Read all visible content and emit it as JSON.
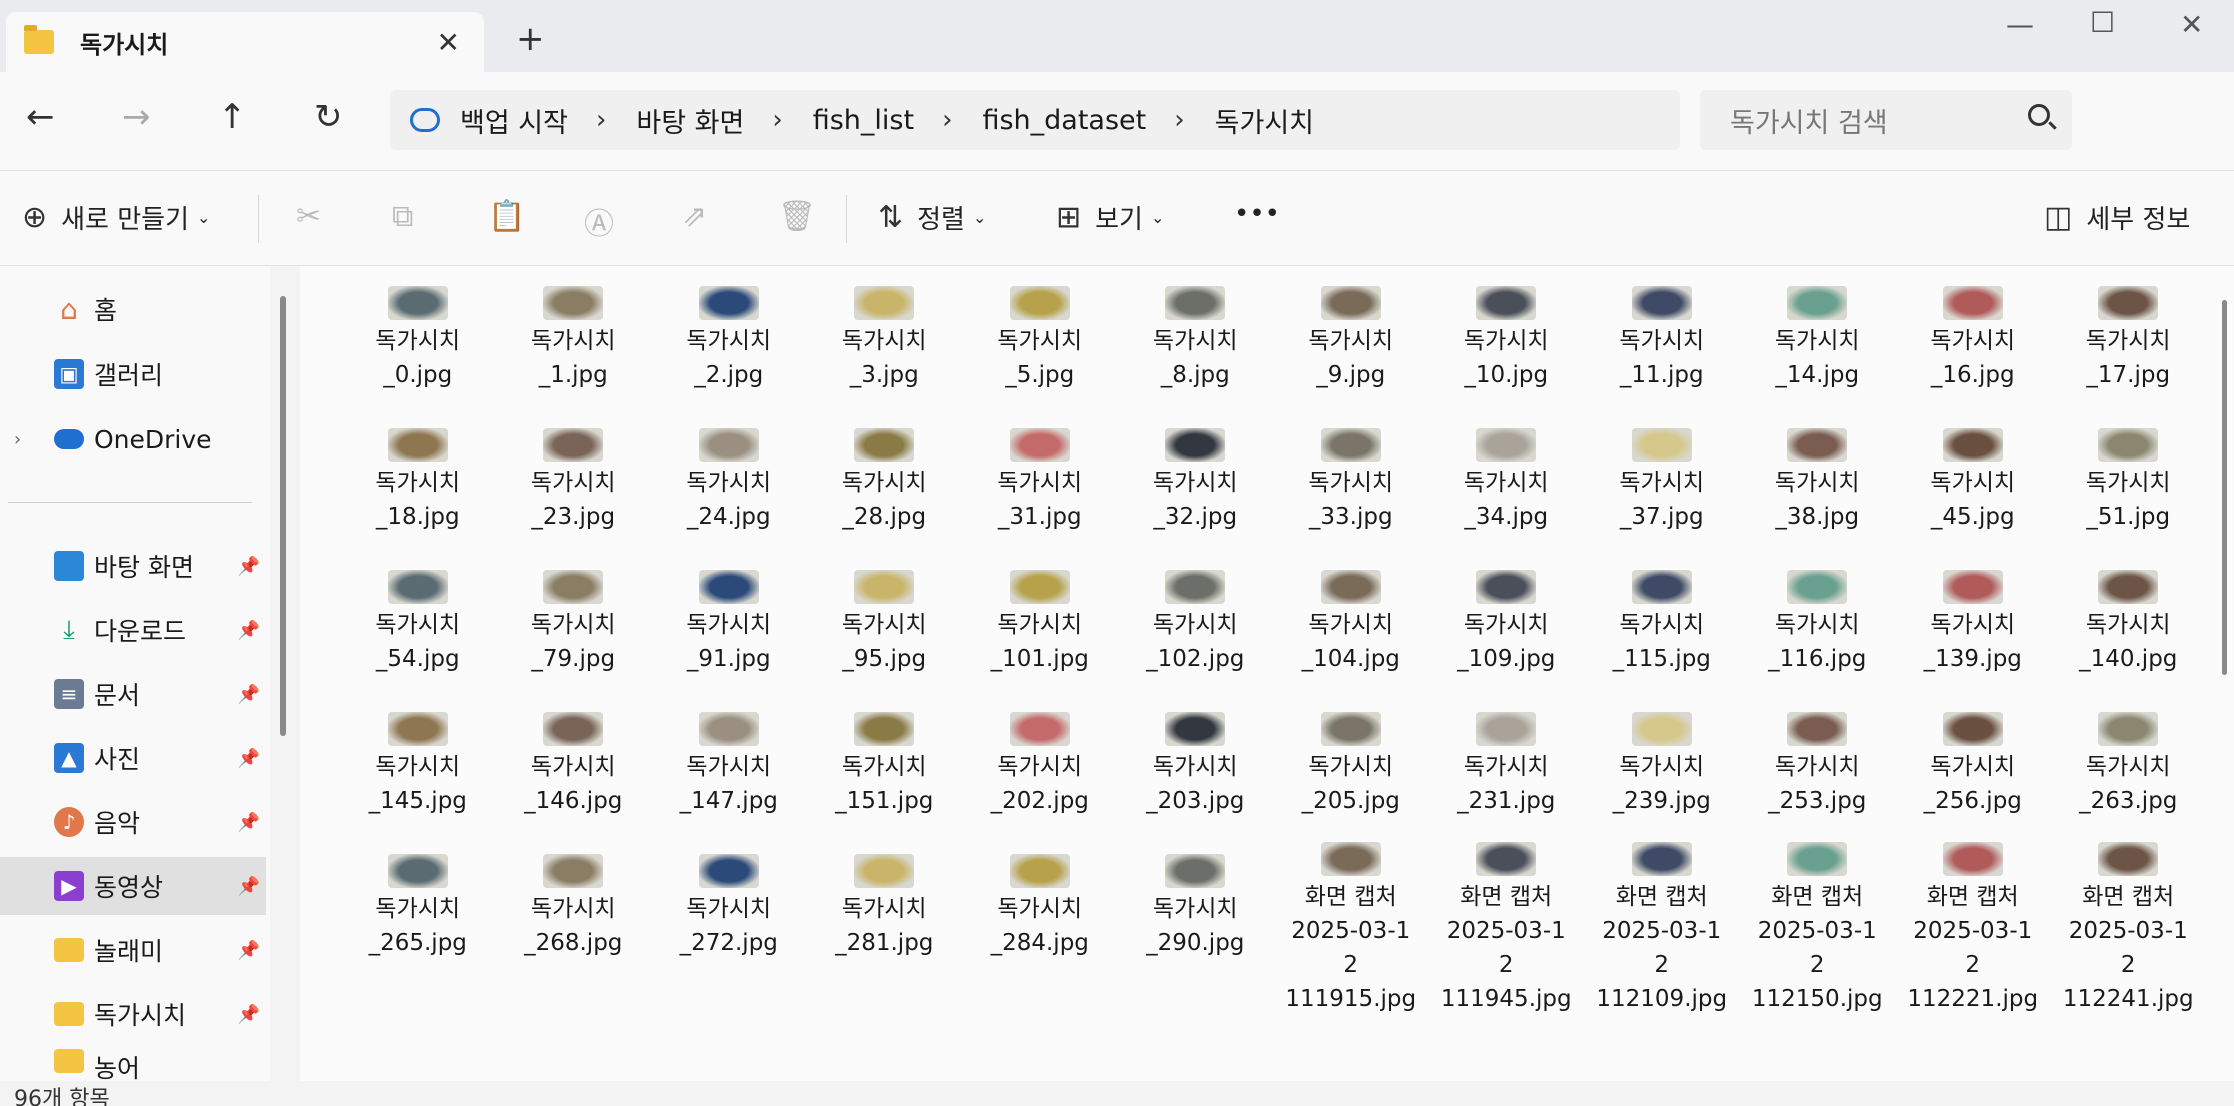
{
  "tab": {
    "title": "독가시치"
  },
  "nav": {
    "breadcrumbs": [
      "백업 시작",
      "바탕 화면",
      "fish_list",
      "fish_dataset",
      "독가시치"
    ],
    "search_placeholder": "독가시치 검색"
  },
  "toolbar": {
    "new_label": "새로 만들기",
    "sort_label": "정렬",
    "view_label": "보기",
    "more_label": "•••",
    "details_label": "세부 정보"
  },
  "sidebar": {
    "top": [
      {
        "label": "홈",
        "icon": "home-icon"
      },
      {
        "label": "갤러리",
        "icon": "gallery-icon"
      },
      {
        "label": "OneDrive",
        "icon": "onedrive-icon"
      }
    ],
    "pinned": [
      {
        "label": "바탕 화면",
        "icon": "desktop-icon",
        "color": "#2b88d8"
      },
      {
        "label": "다운로드",
        "icon": "download-icon",
        "color": "#1a9b6c"
      },
      {
        "label": "문서",
        "icon": "document-icon",
        "color": "#6b7b93"
      },
      {
        "label": "사진",
        "icon": "photos-icon",
        "color": "#2a7ad5"
      },
      {
        "label": "음악",
        "icon": "music-icon",
        "color": "#e0784b"
      },
      {
        "label": "동영상",
        "icon": "video-icon",
        "color": "#8b3fd1"
      },
      {
        "label": "놀래미",
        "icon": "folder-icon",
        "color": "#f4c542"
      },
      {
        "label": "독가시치",
        "icon": "folder-icon",
        "color": "#f4c542"
      },
      {
        "label": "농어",
        "icon": "folder-icon",
        "color": "#f4c542"
      }
    ]
  },
  "files": [
    [
      "독가시치",
      "_0.jpg"
    ],
    [
      "독가시치",
      "_1.jpg"
    ],
    [
      "독가시치",
      "_2.jpg"
    ],
    [
      "독가시치",
      "_3.jpg"
    ],
    [
      "독가시치",
      "_5.jpg"
    ],
    [
      "독가시치",
      "_8.jpg"
    ],
    [
      "독가시치",
      "_9.jpg"
    ],
    [
      "독가시치",
      "_10.jpg"
    ],
    [
      "독가시치",
      "_11.jpg"
    ],
    [
      "독가시치",
      "_14.jpg"
    ],
    [
      "독가시치",
      "_16.jpg"
    ],
    [
      "독가시치",
      "_17.jpg"
    ],
    [
      "독가시치",
      "_18.jpg"
    ],
    [
      "독가시치",
      "_23.jpg"
    ],
    [
      "독가시치",
      "_24.jpg"
    ],
    [
      "독가시치",
      "_28.jpg"
    ],
    [
      "독가시치",
      "_31.jpg"
    ],
    [
      "독가시치",
      "_32.jpg"
    ],
    [
      "독가시치",
      "_33.jpg"
    ],
    [
      "독가시치",
      "_34.jpg"
    ],
    [
      "독가시치",
      "_37.jpg"
    ],
    [
      "독가시치",
      "_38.jpg"
    ],
    [
      "독가시치",
      "_45.jpg"
    ],
    [
      "독가시치",
      "_51.jpg"
    ],
    [
      "독가시치",
      "_54.jpg"
    ],
    [
      "독가시치",
      "_79.jpg"
    ],
    [
      "독가시치",
      "_91.jpg"
    ],
    [
      "독가시치",
      "_95.jpg"
    ],
    [
      "독가시치",
      "_101.jpg"
    ],
    [
      "독가시치",
      "_102.jpg"
    ],
    [
      "독가시치",
      "_104.jpg"
    ],
    [
      "독가시치",
      "_109.jpg"
    ],
    [
      "독가시치",
      "_115.jpg"
    ],
    [
      "독가시치",
      "_116.jpg"
    ],
    [
      "독가시치",
      "_139.jpg"
    ],
    [
      "독가시치",
      "_140.jpg"
    ],
    [
      "독가시치",
      "_145.jpg"
    ],
    [
      "독가시치",
      "_146.jpg"
    ],
    [
      "독가시치",
      "_147.jpg"
    ],
    [
      "독가시치",
      "_151.jpg"
    ],
    [
      "독가시치",
      "_202.jpg"
    ],
    [
      "독가시치",
      "_203.jpg"
    ],
    [
      "독가시치",
      "_205.jpg"
    ],
    [
      "독가시치",
      "_231.jpg"
    ],
    [
      "독가시치",
      "_239.jpg"
    ],
    [
      "독가시치",
      "_253.jpg"
    ],
    [
      "독가시치",
      "_256.jpg"
    ],
    [
      "독가시치",
      "_263.jpg"
    ],
    [
      "독가시치",
      "_265.jpg"
    ],
    [
      "독가시치",
      "_268.jpg"
    ],
    [
      "독가시치",
      "_272.jpg"
    ],
    [
      "독가시치",
      "_281.jpg"
    ],
    [
      "독가시치",
      "_284.jpg"
    ],
    [
      "독가시치",
      "_290.jpg"
    ],
    [
      "화면 캡처",
      "2025-03-1",
      "2",
      "111915.jpg"
    ],
    [
      "화면 캡처",
      "2025-03-1",
      "2",
      "111945.jpg"
    ],
    [
      "화면 캡처",
      "2025-03-1",
      "2",
      "112109.jpg"
    ],
    [
      "화면 캡처",
      "2025-03-1",
      "2",
      "112150.jpg"
    ],
    [
      "화면 캡처",
      "2025-03-1",
      "2",
      "112221.jpg"
    ],
    [
      "화면 캡처",
      "2025-03-1",
      "2",
      "112241.jpg"
    ]
  ],
  "thumb_colors": [
    "#5a6b72",
    "#8a7d64",
    "#2b4a7a",
    "#c9b56a",
    "#b7a14a",
    "#6c6f69",
    "#7a6a58",
    "#4b4f5a",
    "#3f4a66",
    "#6aa08f",
    "#b05a5a",
    "#6c5446",
    "#8d7650",
    "#7a6458",
    "#9a8f80",
    "#8a7a45",
    "#c46a6a",
    "#333840",
    "#7a7568",
    "#a9a39a",
    "#d6c88a",
    "#7a5c50",
    "#6a5040",
    "#8a8670"
  ],
  "status": {
    "count": "96개 항목"
  }
}
